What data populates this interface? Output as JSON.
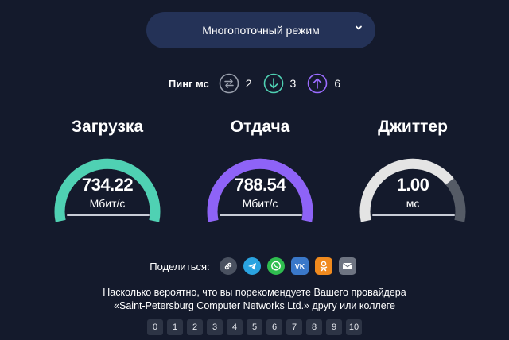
{
  "mode_select": {
    "label": "Многопоточный режим"
  },
  "ping": {
    "label": "Пинг мс",
    "items": [
      {
        "icon": "swap-arrows-icon",
        "value": "2",
        "color": "#9aa0ad"
      },
      {
        "icon": "arrow-down-circle-icon",
        "value": "3",
        "color": "#4fd1b3"
      },
      {
        "icon": "arrow-up-circle-icon",
        "value": "6",
        "color": "#9b6cff"
      }
    ]
  },
  "metrics": [
    {
      "title": "Загрузка",
      "value": "734.22",
      "unit": "Мбит/с",
      "color": "#4fd1b3",
      "fill": 1.0
    },
    {
      "title": "Отдача",
      "value": "788.54",
      "unit": "Мбит/с",
      "color": "#8e63f7",
      "fill": 1.0
    },
    {
      "title": "Джиттер",
      "value": "1.00",
      "unit": "мс",
      "color": "#e4e4e4",
      "fill": 0.75
    }
  ],
  "share": {
    "label": "Поделиться:",
    "icons": [
      "link-icon",
      "telegram-icon",
      "whatsapp-icon",
      "vk-icon",
      "odnoklassniki-icon",
      "mail-icon"
    ]
  },
  "question": {
    "line1": "Насколько вероятно, что вы порекомендуете Вашего провайдера",
    "line2": "«Saint-Petersburg Computer Networks Ltd.» другу или коллеге"
  },
  "scale": [
    "0",
    "1",
    "2",
    "3",
    "4",
    "5",
    "6",
    "7",
    "8",
    "9",
    "10"
  ]
}
